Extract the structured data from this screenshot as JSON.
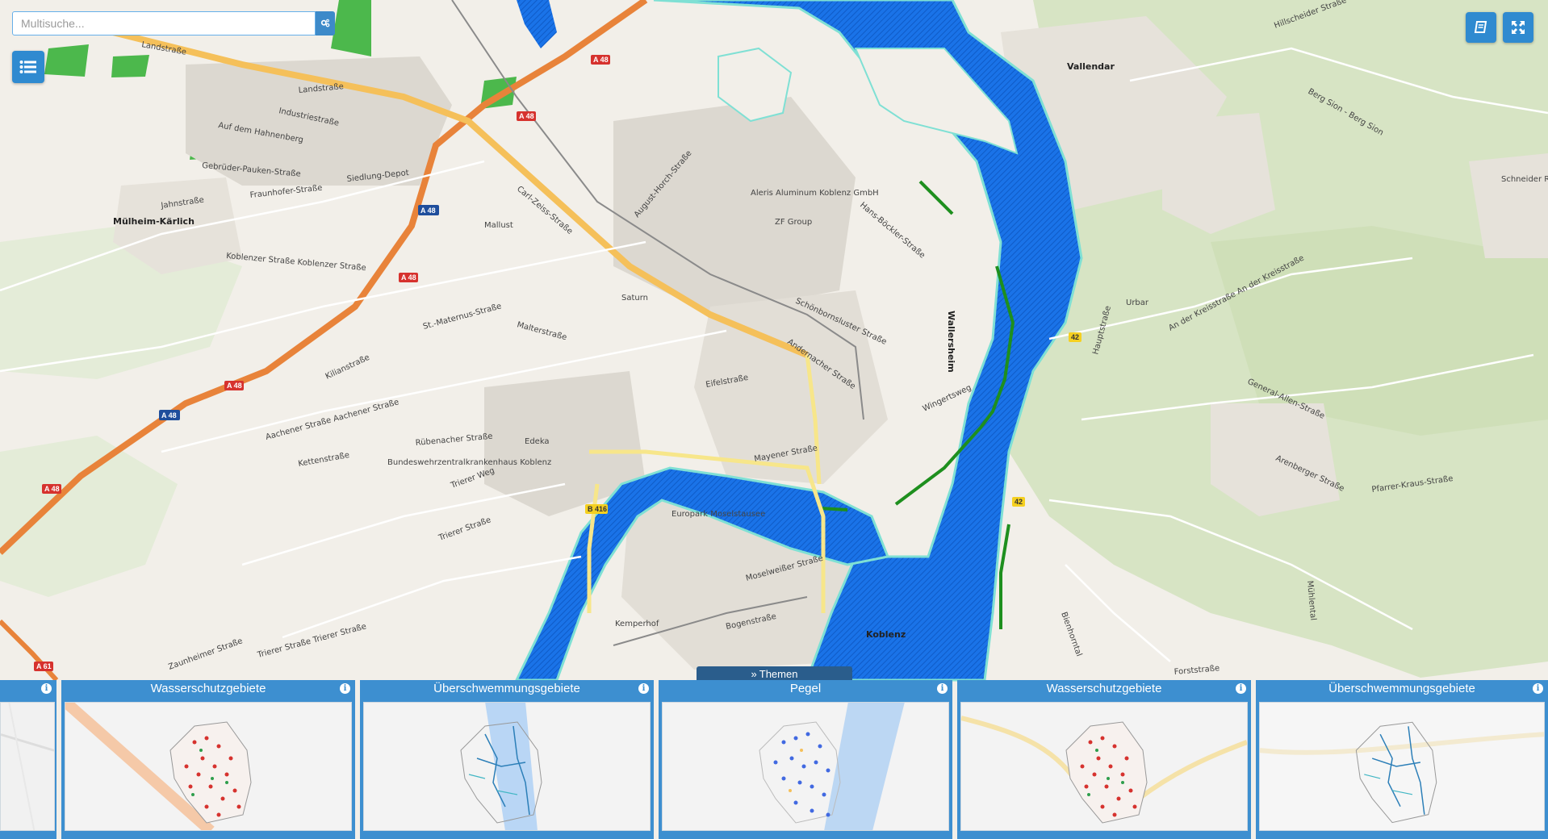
{
  "search": {
    "placeholder": "Multisuche..."
  },
  "controls": {
    "layers_icon": "list-icon",
    "search_icon": "cogs-icon",
    "book_icon": "book-icon",
    "fullscreen_icon": "expand-icon"
  },
  "map": {
    "labels": {
      "landstrasse": "Landstraße",
      "industriestrasse": "Industriestraße",
      "auf_dem_hahnenberg": "Auf dem Hahnenberg",
      "gebrueder_pauken": "Gebrüder-Pauken-Straße",
      "fraunhofer": "Fraunhofer-Straße",
      "siedlung_depot": "Siedlung-Depot",
      "jahnstrasse": "Jahnstraße",
      "muelheim_kaerlich": "Mülheim-Kärlich",
      "koblenzer_strasse": "Koblenzer Straße Koblenzer Straße",
      "carl_zeiss": "Carl-Zeiss-Straße",
      "august_horch": "August-Horch-Straße",
      "aleris": "Aleris Aluminum Koblenz GmbH",
      "zf_group": "ZF Group",
      "saturn": "Saturn",
      "mallust": "Mallust",
      "maiterstrasse": "Malterstraße",
      "st_maternus": "St.-Maternus-Straße",
      "kilianstrasse": "Kilianstraße",
      "aachener_strasse": "Aachener Straße Aachener Straße",
      "kettenstrasse": "Kettenstraße",
      "ruebenacher": "Rübenacher Straße",
      "bundeswehr": "Bundeswehrzentralkrankenhaus Koblenz",
      "trierer_weg": "Trierer Weg",
      "trierer_strasse": "Trierer Straße",
      "edeka": "Edeka",
      "eifelstrasse": "Eifelstraße",
      "mayener_strasse": "Mayener Straße",
      "andernacher_strasse": "Andernacher Straße",
      "schoenbornsluster": "Schönbornsluster Straße",
      "hans_boeckler": "Hans-Böckler-Straße",
      "wallersheim": "Wallersheim",
      "wingertsweg": "Wingertsweg",
      "europark": "Europark Moselstausee",
      "moselweisser": "Moselweißer Straße",
      "bogenstrasse": "Bogenstraße",
      "kemperhof": "Kemperhof",
      "koblenz": "Koblenz",
      "vallendar": "Vallendar",
      "urbar": "Urbar",
      "general_allen": "General-Allen-Straße",
      "arenberger": "Arenberger Straße",
      "pfarrer_kraus": "Pfarrer-Kraus-Straße",
      "berg_sion": "Berg Sion - Berg Sion",
      "hillscheider": "Hillscheider Straße",
      "schneider_re": "Schneider Re",
      "an_der_kreisstrasse": "An der Kreisstraße An der Kreisstraße",
      "hauptstrasse": "Hauptstraße",
      "bienhorntal": "Bienhorntal",
      "forststrasse": "Forststraße",
      "muehlental": "Mühlental",
      "zaunheimer": "Zaunheimer Straße",
      "trierer_strasse_2": "Trierer Straße Trierer Straße"
    },
    "shields": {
      "a48_1": "A 48",
      "a48_2": "A 48",
      "a48_3": "A 48",
      "a48_4": "A 48",
      "a48_5": "A 48",
      "a48_6": "A 48",
      "a48_7": "A 48",
      "a61": "A 61",
      "b416": "B 416",
      "b42_1": "42",
      "b42_2": "42"
    }
  },
  "themen": {
    "label": "Themen",
    "icon": "chevron-double-down-icon"
  },
  "cards": [
    {
      "title": "Wasserschutzgebiete",
      "info_icon": "info-icon"
    },
    {
      "title": "Überschwemmungsgebiete",
      "info_icon": "info-icon"
    },
    {
      "title": "Pegel",
      "info_icon": "info-icon"
    },
    {
      "title": "Wasserschutzgebiete",
      "info_icon": "info-icon"
    },
    {
      "title": "Überschwemmungsgebiete",
      "info_icon": "info-icon"
    }
  ],
  "colors": {
    "water": "#1a73e8",
    "water_hatch": "#0f5bc7",
    "flood_border": "#7fe0d4",
    "autobahn": "#e8833a",
    "primary_road": "#f5c05a",
    "secondary_road": "#f7e68a",
    "accent": "#2f8ad0"
  }
}
